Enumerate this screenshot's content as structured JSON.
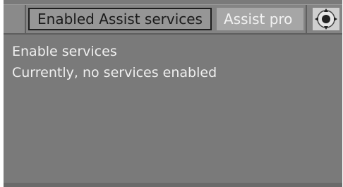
{
  "tabs": [
    {
      "label": "Enabled Assist services",
      "selected": true
    },
    {
      "label": "Assist pro",
      "selected": false
    }
  ],
  "controller_icon": "controller-knob-icon",
  "content": {
    "heading": "Enable services",
    "status": "Currently, no services enabled"
  },
  "colors": {
    "background": "#7a7a7a",
    "text": "#efefef"
  }
}
